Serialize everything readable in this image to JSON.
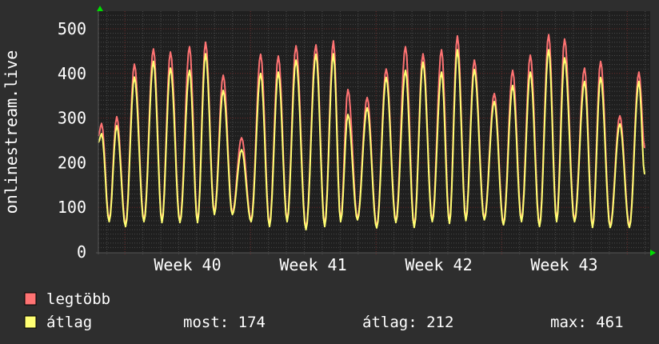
{
  "chart_data": {
    "type": "line",
    "ylabel": "onlinestream.live",
    "xlabel": "",
    "x_unit": "days",
    "xlim": [
      0,
      30.9
    ],
    "ylim": [
      0,
      540
    ],
    "yticks": [
      0,
      100,
      200,
      300,
      400,
      500
    ],
    "ytick_labels": [
      "0",
      "100",
      "200",
      "300",
      "400",
      "500"
    ],
    "week_boundaries": [
      1.48,
      8.52,
      15.56,
      22.6,
      29.64
    ],
    "xtick_labels": [
      {
        "label": "Week 40",
        "day": 5.0
      },
      {
        "label": "Week 41",
        "day": 12.04
      },
      {
        "label": "Week 42",
        "day": 19.08
      },
      {
        "label": "Week 43",
        "day": 26.12
      }
    ],
    "grid": true,
    "colors": {
      "max": "#ff7373",
      "avg": "#ffff73",
      "background": "#2e2e2e",
      "plot": "#1f1f1f",
      "arrow": "#00dd00"
    },
    "start": {
      "day": 0,
      "max": 260,
      "avg": 245
    },
    "peaks": [
      {
        "day": 0.18,
        "max": 288,
        "avg": 265,
        "trough": 68
      },
      {
        "day": 1.03,
        "max": 303,
        "avg": 283,
        "trough": 57
      },
      {
        "day": 2.02,
        "max": 421,
        "avg": 392,
        "trough": 68
      },
      {
        "day": 3.09,
        "max": 455,
        "avg": 427,
        "trough": 66
      },
      {
        "day": 4.04,
        "max": 448,
        "avg": 412,
        "trough": 66
      },
      {
        "day": 5.11,
        "max": 460,
        "avg": 407,
        "trough": 66
      },
      {
        "day": 6.01,
        "max": 470,
        "avg": 444,
        "trough": 84
      },
      {
        "day": 7.0,
        "max": 396,
        "avg": 362,
        "trough": 84
      },
      {
        "day": 8.03,
        "max": 256,
        "avg": 229,
        "trough": 68
      },
      {
        "day": 9.1,
        "max": 443,
        "avg": 400,
        "trough": 57
      },
      {
        "day": 10.09,
        "max": 439,
        "avg": 403,
        "trough": 68
      },
      {
        "day": 11.08,
        "max": 462,
        "avg": 430,
        "trough": 50
      },
      {
        "day": 12.2,
        "max": 464,
        "avg": 443,
        "trough": 57
      },
      {
        "day": 13.18,
        "max": 473,
        "avg": 444,
        "trough": 68
      },
      {
        "day": 13.99,
        "max": 364,
        "avg": 308,
        "trough": 72
      },
      {
        "day": 15.07,
        "max": 346,
        "avg": 323,
        "trough": 54
      },
      {
        "day": 16.14,
        "max": 410,
        "avg": 391,
        "trough": 66
      },
      {
        "day": 17.22,
        "max": 460,
        "avg": 407,
        "trough": 55
      },
      {
        "day": 18.2,
        "max": 444,
        "avg": 425,
        "trough": 68
      },
      {
        "day": 19.24,
        "max": 453,
        "avg": 403,
        "trough": 64
      },
      {
        "day": 20.13,
        "max": 484,
        "avg": 453,
        "trough": 70
      },
      {
        "day": 21.08,
        "max": 430,
        "avg": 409,
        "trough": 72
      },
      {
        "day": 22.2,
        "max": 355,
        "avg": 337,
        "trough": 61
      },
      {
        "day": 23.23,
        "max": 407,
        "avg": 373,
        "trough": 68
      },
      {
        "day": 24.22,
        "max": 441,
        "avg": 403,
        "trough": 57
      },
      {
        "day": 25.25,
        "max": 487,
        "avg": 453,
        "trough": 68
      },
      {
        "day": 26.14,
        "max": 477,
        "avg": 435,
        "trough": 68
      },
      {
        "day": 27.26,
        "max": 412,
        "avg": 382,
        "trough": 55
      },
      {
        "day": 28.16,
        "max": 427,
        "avg": 391,
        "trough": 55
      },
      {
        "day": 29.24,
        "max": 305,
        "avg": 287,
        "trough": 55
      },
      {
        "day": 30.31,
        "max": 403,
        "avg": 382,
        "trough": null
      }
    ],
    "end": {
      "day": 30.63,
      "max": 233,
      "avg": 174
    },
    "legend": {
      "placement": "bottom-left",
      "max_label": "legtöbb",
      "avg_label": "átlag",
      "now": "most: 174",
      "average": "átlag: 212",
      "maximum": "max: 461"
    }
  }
}
